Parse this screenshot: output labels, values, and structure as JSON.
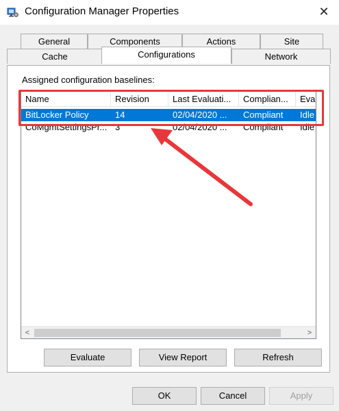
{
  "window": {
    "title": "Configuration Manager Properties",
    "close_glyph": "✕"
  },
  "tabs": {
    "row_back": [
      "General",
      "Components",
      "Actions",
      "Site"
    ],
    "row_front": [
      "Cache",
      "Configurations",
      "Network"
    ],
    "active": "Configurations"
  },
  "panel": {
    "group_label": "Assigned configuration baselines:"
  },
  "list": {
    "columns": [
      "Name",
      "Revision",
      "Last Evaluati...",
      "Complian...",
      "Eva"
    ],
    "rows": [
      [
        "BitLocker Policy",
        "14",
        "02/04/2020 ...",
        "Compliant",
        "Idle"
      ],
      [
        "CoMgmtSettingsPr...",
        "3",
        "02/04/2020 ...",
        "Compliant",
        "Idle"
      ]
    ],
    "selected_row": 0,
    "scroll_left": "<",
    "scroll_right": ">"
  },
  "panel_buttons": {
    "evaluate": "Evaluate",
    "view_report": "View Report",
    "refresh": "Refresh"
  },
  "dialog_buttons": {
    "ok": "OK",
    "cancel": "Cancel",
    "apply": "Apply"
  },
  "colors": {
    "selection": "#0078d7",
    "annotation": "#e8373a"
  }
}
